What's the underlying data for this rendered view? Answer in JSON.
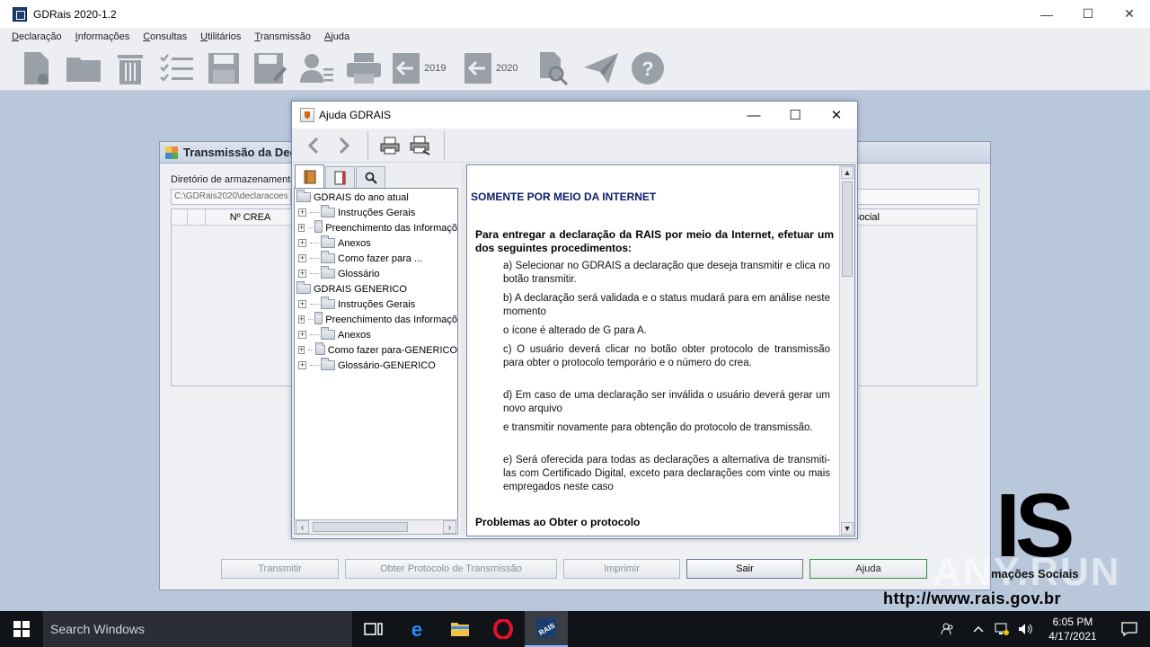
{
  "app": {
    "title": "GDRais 2020-1.2",
    "menu": [
      "Declaração",
      "Informações",
      "Consultas",
      "Utilitários",
      "Transmissão",
      "Ajuda"
    ],
    "toolbar_years": [
      "2019",
      "2020"
    ],
    "window_controls": {
      "minimize": "—",
      "maximize": "☐",
      "close": "✕"
    }
  },
  "trans_dialog": {
    "title": "Transmissão da Dec",
    "dir_label": "Diretório de armazenamento",
    "dir_value": "C:\\GDRais2020\\declaracoes",
    "columns": [
      "",
      "Nº CREA"
    ],
    "right_column": "Social",
    "buttons": {
      "transmitir": "Transmitir",
      "protocolo": "Obter Protocolo de Transmissão",
      "imprimir": "Imprimir",
      "sair": "Sair",
      "ajuda": "Ajuda"
    }
  },
  "brand": {
    "logo": "IS",
    "subtitle": "mações Sociais",
    "url": "http://www.rais.gov.br",
    "watermark": "ANY.RUN"
  },
  "help": {
    "title": "Ajuda GDRAIS",
    "tree": [
      {
        "label": "GDRAIS do ano atual",
        "level": 0
      },
      {
        "label": "Instruções Gerais",
        "level": 1
      },
      {
        "label": "Preenchimento das Informaçõ",
        "level": 1
      },
      {
        "label": "Anexos",
        "level": 1
      },
      {
        "label": "Como fazer para ...",
        "level": 1
      },
      {
        "label": "Glossário",
        "level": 1
      },
      {
        "label": "GDRAIS GENERICO",
        "level": 0
      },
      {
        "label": "Instruções Gerais",
        "level": 1
      },
      {
        "label": "Preenchimento das Informaçõ",
        "level": 1
      },
      {
        "label": "Anexos",
        "level": 1
      },
      {
        "label": "Como fazer para-GENERICO",
        "level": 1
      },
      {
        "label": "Glossário-GENERICO",
        "level": 1
      }
    ],
    "content": {
      "heading": "SOMENTE POR MEIO DA INTERNET",
      "intro": "Para entregar a declaração da RAIS por meio da Internet, efetuar um dos seguintes procedimentos:",
      "p_a": "a) Selecionar no GDRAIS a declaração que deseja transmitir e clica no botão transmitir.",
      "p_b": "b) A declaração será validada e o status mudará para em análise neste momento",
      "p_icon": "o ícone é alterado de G para A.",
      "p_c": "c) O usuário deverá clicar no botão obter protocolo de transmissão para obter o protocolo temporário e o número do crea.",
      "p_d": "d) Em caso de uma declaração ser inválida o usuário deverá gerar um novo arquivo",
      "p_e1": "e transmitir novamente para obtenção do protocolo de transmissão.",
      "p_e": "e) Será oferecida para todas as declarações a alternativa de transmiti-las com Certificado Digital, exceto para declarações com vinte ou mais empregados neste caso",
      "problems": "Problemas ao Obter o protocolo"
    }
  },
  "taskbar": {
    "search_placeholder": "Search Windows",
    "time": "6:05 PM",
    "date": "4/17/2021"
  }
}
